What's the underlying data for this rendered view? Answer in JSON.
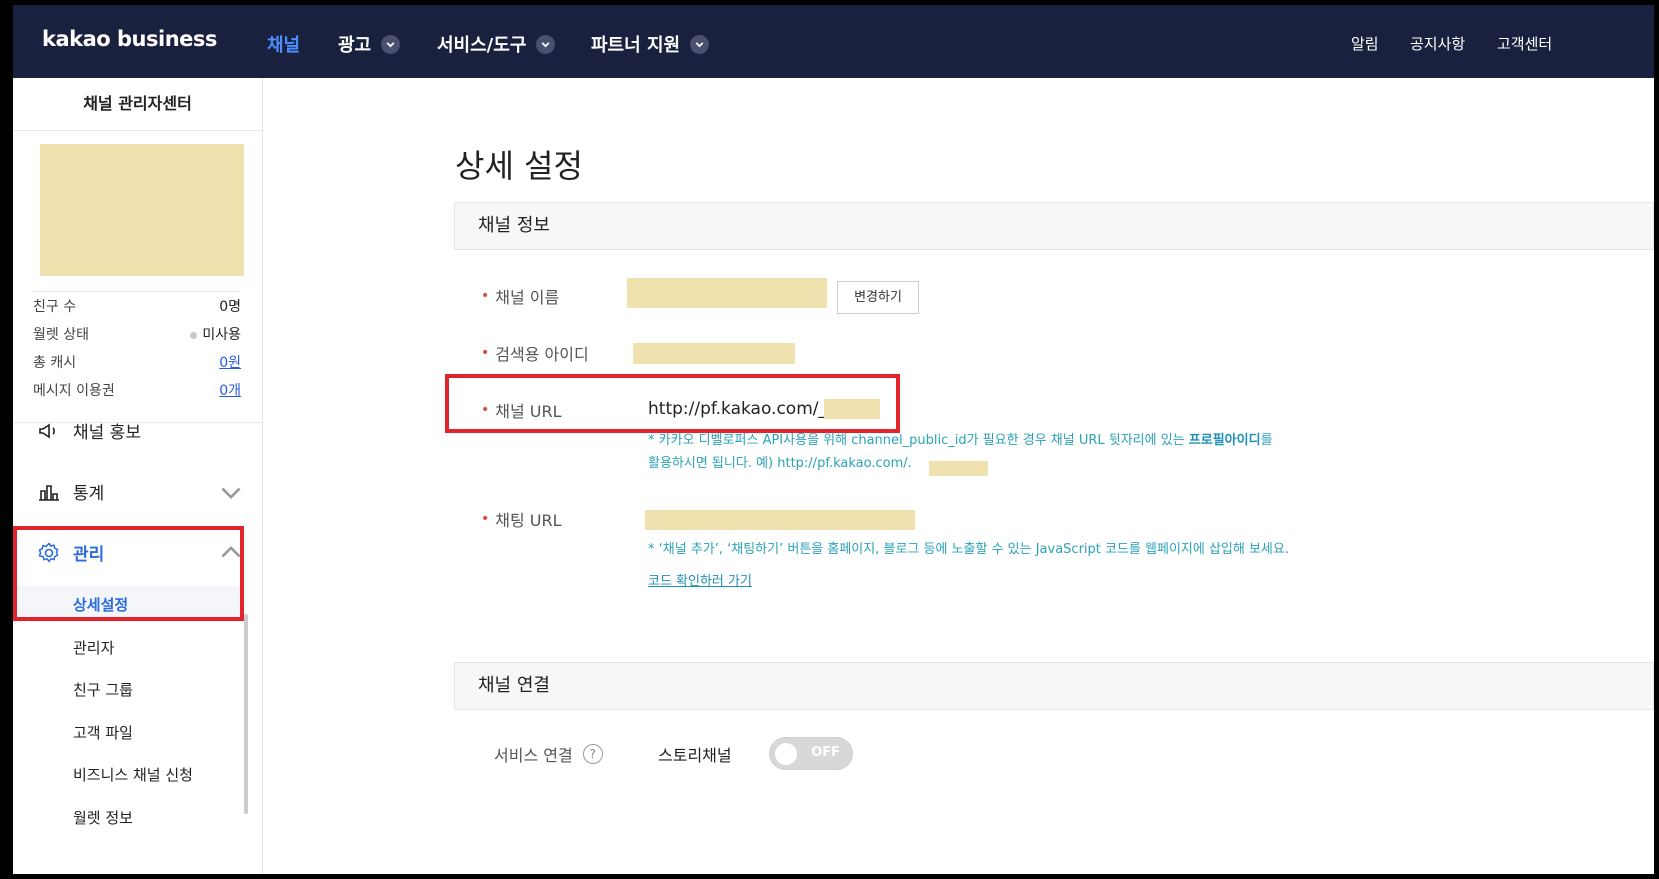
{
  "topnav": {
    "logo": "kakao business",
    "items": [
      {
        "label": "채널",
        "active": true
      },
      {
        "label": "광고"
      },
      {
        "label": "서비스/도구"
      },
      {
        "label": "파트너 지원"
      }
    ],
    "right": [
      "알림",
      "공지사항",
      "고객센터"
    ]
  },
  "sidebar": {
    "title": "채널 관리자센터",
    "stats": [
      {
        "label": "친구 수",
        "value": "0명"
      },
      {
        "label": "월렛 상태",
        "value": "미사용"
      },
      {
        "label": "총 캐시",
        "value": "0원"
      },
      {
        "label": "메시지 이용권",
        "value": "0개"
      }
    ],
    "menu": {
      "promo": "채널 홍보",
      "stats": "통계",
      "manage": "관리"
    },
    "submenu": [
      "상세설정",
      "관리자",
      "친구 그룹",
      "고객 파일",
      "비즈니스 채널 신청",
      "월렛 정보"
    ]
  },
  "main": {
    "title": "상세 설정",
    "section1": "채널 정보",
    "fields": {
      "name": "채널 이름",
      "change_button": "변경하기",
      "search_id": "검색용 아이디",
      "url": "채널 URL",
      "url_value": "http://pf.kakao.com/_",
      "url_note1": "* 카카오 디벨로퍼스 API사용을 위해 channel_public_id가 필요한 경우 채널 URL 뒷자리에 있는 ",
      "url_note_bold": "프로필아이디",
      "url_note1_end": "를",
      "url_note2": "활용하시면 됩니다. 예) http://pf.kakao.com/.",
      "chat_url": "채팅 URL",
      "chat_note": "* ‘채널 추가’, ‘채팅하기’ 버튼을 홈페이지, 블로그 등에 노출할 수 있는 JavaScript 코드를 웹페이지에 삽입해 보세요.",
      "code_link": "코드 확인하러 가기"
    },
    "section2": "채널 연결",
    "service": {
      "label": "서비스 연결",
      "help": "?",
      "story": "스토리채널",
      "toggle": "OFF"
    }
  },
  "colors": {
    "nav_bg": "#19213f",
    "accent": "#2a6cdf",
    "highlight": "#e0242c",
    "mask": "#efe2ae"
  }
}
